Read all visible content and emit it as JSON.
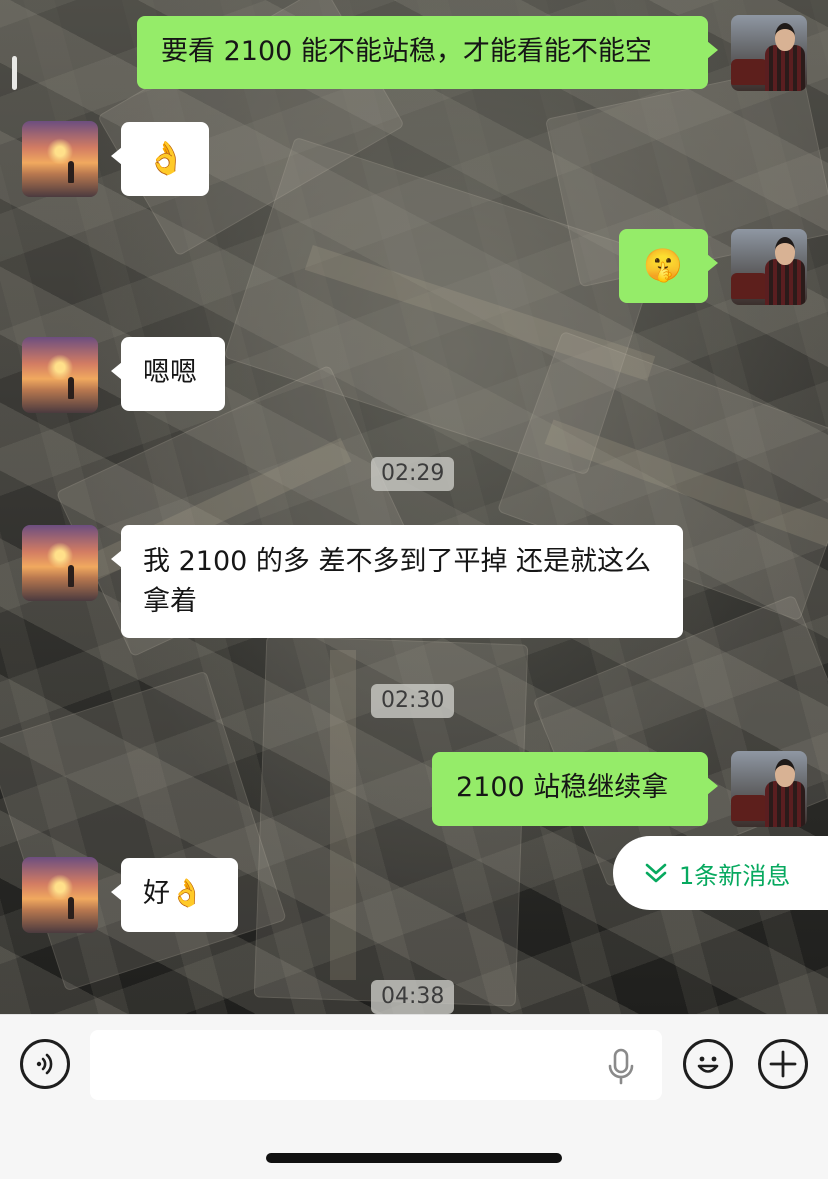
{
  "messages": [
    {
      "side": "out",
      "text": "要看 2100 能不能站稳，才能看能不能空"
    },
    {
      "side": "in",
      "text": "👌"
    },
    {
      "side": "out",
      "text": "🤫"
    },
    {
      "side": "in",
      "text": "嗯嗯"
    },
    {
      "side": "in",
      "text": "我 2100 的多  差不多到了平掉 还是就这么拿着"
    },
    {
      "side": "out",
      "text": "2100 站稳继续拿"
    },
    {
      "side": "in",
      "text": "好👌"
    }
  ],
  "timestamps": [
    "02:29",
    "02:30",
    "04:38"
  ],
  "new_message_pill": {
    "label": "1条新消息",
    "icon": "double-chevron-down-icon",
    "color": "#07a95f"
  },
  "input_bar": {
    "voice_icon": "voice-toggle-icon",
    "mic_icon": "microphone-icon",
    "emoji_icon": "emoji-icon",
    "plus_icon": "plus-icon"
  },
  "colors": {
    "outgoing_bubble": "#95ec69",
    "incoming_bubble": "#ffffff",
    "input_bar": "#f6f6f6"
  }
}
